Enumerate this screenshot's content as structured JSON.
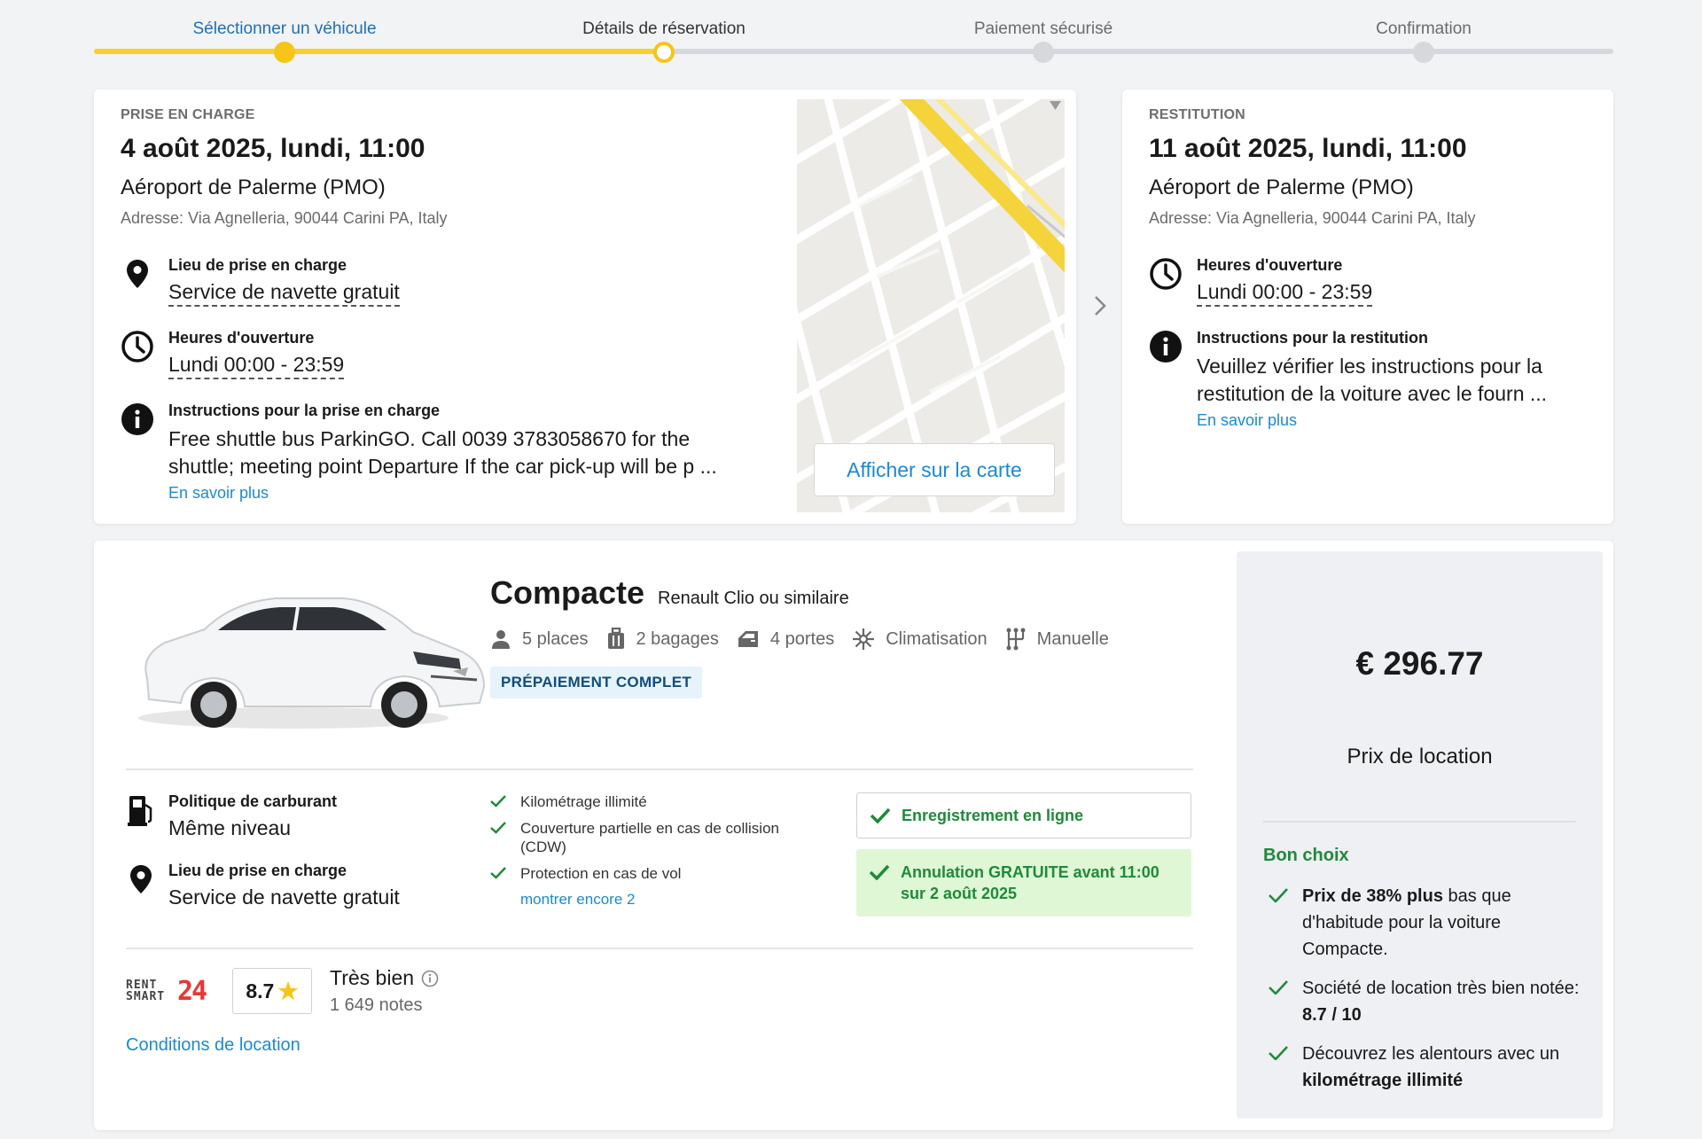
{
  "stepper": {
    "steps": [
      {
        "label": "Sélectionner un véhicule"
      },
      {
        "label": "Détails de réservation"
      },
      {
        "label": "Paiement sécurisé"
      },
      {
        "label": "Confirmation"
      }
    ]
  },
  "pickup": {
    "eyebrow": "PRISE EN CHARGE",
    "date": "4 août 2025, lundi, 11:00",
    "location": "Aéroport de Palerme (PMO)",
    "address": "Adresse: Via Agnelleria, 90044 Carini PA, Italy",
    "place_title": "Lieu de prise en charge",
    "place_value": "Service de navette gratuit",
    "hours_title": "Heures d'ouverture",
    "hours_value": "Lundi 00:00 - 23:59",
    "instr_title": "Instructions pour la prise en charge",
    "instr_line1": "Free shuttle bus ParkinGO. Call 0039 3783058670 for the",
    "instr_line2": "shuttle; meeting point Departure If the car pick-up will be p ...",
    "more": "En savoir plus",
    "map_button": "Afficher sur la carte"
  },
  "return": {
    "eyebrow": "RESTITUTION",
    "date": "11 août 2025, lundi, 11:00",
    "location": "Aéroport de Palerme (PMO)",
    "address": "Adresse: Via Agnelleria, 90044 Carini PA, Italy",
    "hours_title": "Heures d'ouverture",
    "hours_value": "Lundi 00:00 - 23:59",
    "instr_title": "Instructions pour la restitution",
    "instr_line1": "Veuillez vérifier les instructions pour la",
    "instr_line2": "restitution de la voiture avec le fourn ...",
    "more": "En savoir plus"
  },
  "car": {
    "class": "Compacte",
    "model": "Renault Clio ou similaire",
    "specs": {
      "seats": "5 places",
      "bags": "2 bagages",
      "doors": "4 portes",
      "ac": "Climatisation",
      "gear": "Manuelle"
    },
    "badge": "PRÉPAIEMENT COMPLET",
    "fuel_title": "Politique de carburant",
    "fuel_value": "Même niveau",
    "place_title": "Lieu de prise en charge",
    "place_value": "Service de navette gratuit",
    "inclusions": [
      "Kilométrage illimité",
      "Couverture partielle en cas de collision (CDW)",
      "Protection en cas de vol"
    ],
    "show_more": "montrer encore 2",
    "online_checkin": "Enregistrement en ligne",
    "free_cancel": "Annulation GRATUITE avant 11:00 sur 2 août 2025",
    "supplier_logo_top": "RENT",
    "supplier_logo_bottom": "SMART",
    "supplier_logo_num": "24",
    "score": "8.7",
    "rating_label": "Très bien",
    "rating_count": "1 649 notes",
    "conditions": "Conditions de location"
  },
  "price": {
    "amount": "€ 296.77",
    "label": "Prix de location",
    "good_title": "Bon choix",
    "item1_bold": "Prix de 38% plus",
    "item1_rest": " bas que d'habitude pour la voiture Compacte.",
    "item2_text": "Société de location très bien notée: ",
    "item2_bold": "8.7 / 10",
    "item3_text": "Découvrez les alentours avec un ",
    "item3_bold": "kilométrage illimité"
  },
  "colors": {
    "accent_yellow": "#f5c518",
    "link_blue": "#1a8ad1",
    "success_green": "#1f8a3a"
  }
}
